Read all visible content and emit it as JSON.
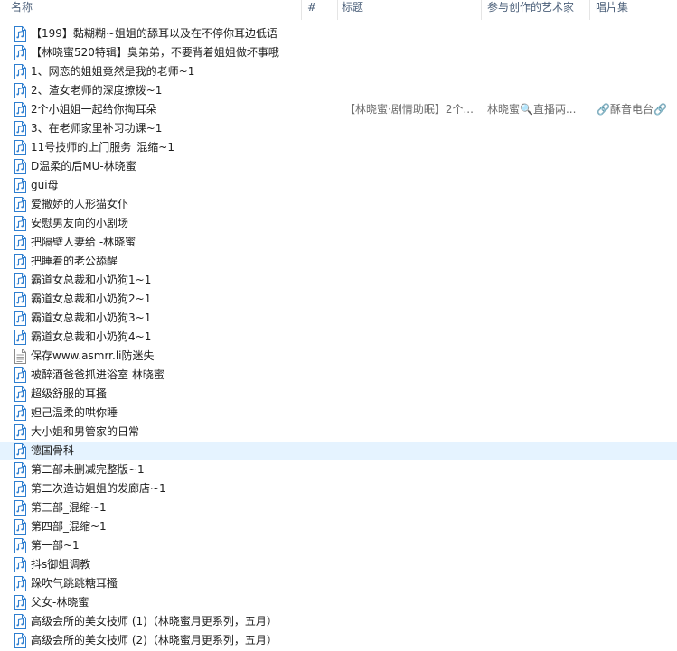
{
  "columns": {
    "name": "名称",
    "number": "#",
    "title": "标题",
    "artist": "参与创作的艺术家",
    "album": "唱片集"
  },
  "files": [
    {
      "name": "【199】黏糊糊~姐姐的舔耳以及在不停你耳边低语",
      "type": "audio"
    },
    {
      "name": "【林晓蜜520特辑】臭弟弟，不要背着姐姐做坏事哦",
      "type": "audio"
    },
    {
      "name": "1、网恋的姐姐竟然是我的老师~1",
      "type": "audio"
    },
    {
      "name": "2、渣女老师的深度撩拨~1",
      "type": "audio"
    },
    {
      "name": "2个小姐姐一起给你掏耳朵",
      "type": "audio",
      "title": "【林晓蜜·剧情助眠】2个...",
      "artist": "林晓蜜🔍直播两...",
      "album": "🔗酥音电台🔗"
    },
    {
      "name": "3、在老师家里补习功课~1",
      "type": "audio"
    },
    {
      "name": "11号技师的上门服务_混缩~1",
      "type": "audio"
    },
    {
      "name": "D温柔的后MU-林晓蜜",
      "type": "audio"
    },
    {
      "name": "gui母",
      "type": "audio"
    },
    {
      "name": "爱撒娇的人形猫女仆",
      "type": "audio"
    },
    {
      "name": "安慰男友向的小剧场",
      "type": "audio"
    },
    {
      "name": "把隔壁人妻给 -林晓蜜",
      "type": "audio"
    },
    {
      "name": "把睡着的老公舔醒",
      "type": "audio"
    },
    {
      "name": "霸道女总裁和小奶狗1~1",
      "type": "audio"
    },
    {
      "name": "霸道女总裁和小奶狗2~1",
      "type": "audio"
    },
    {
      "name": "霸道女总裁和小奶狗3~1",
      "type": "audio"
    },
    {
      "name": "霸道女总裁和小奶狗4~1",
      "type": "audio"
    },
    {
      "name": "保存www.asmrr.li防迷失",
      "type": "text"
    },
    {
      "name": "被醉酒爸爸抓进浴室 林晓蜜",
      "type": "audio"
    },
    {
      "name": "超级舒服的耳搔",
      "type": "audio"
    },
    {
      "name": "妲己温柔的哄你睡",
      "type": "audio"
    },
    {
      "name": "大小姐和男管家的日常",
      "type": "audio"
    },
    {
      "name": "德国骨科",
      "type": "audio",
      "selected": true
    },
    {
      "name": "第二部未删减完整版~1",
      "type": "audio"
    },
    {
      "name": "第二次造访姐姐的发廊店~1",
      "type": "audio"
    },
    {
      "name": "第三部_混缩~1",
      "type": "audio"
    },
    {
      "name": "第四部_混缩~1",
      "type": "audio"
    },
    {
      "name": "第一部~1",
      "type": "audio"
    },
    {
      "name": "抖s御姐调教",
      "type": "audio"
    },
    {
      "name": "跺吹气跳跳糖耳搔",
      "type": "audio"
    },
    {
      "name": "父女-林晓蜜",
      "type": "audio"
    },
    {
      "name": "高级会所的美女技师 (1)（林晓蜜月更系列，五月）",
      "type": "audio"
    },
    {
      "name": "高级会所的美女技师 (2)（林晓蜜月更系列，五月）",
      "type": "audio"
    }
  ]
}
